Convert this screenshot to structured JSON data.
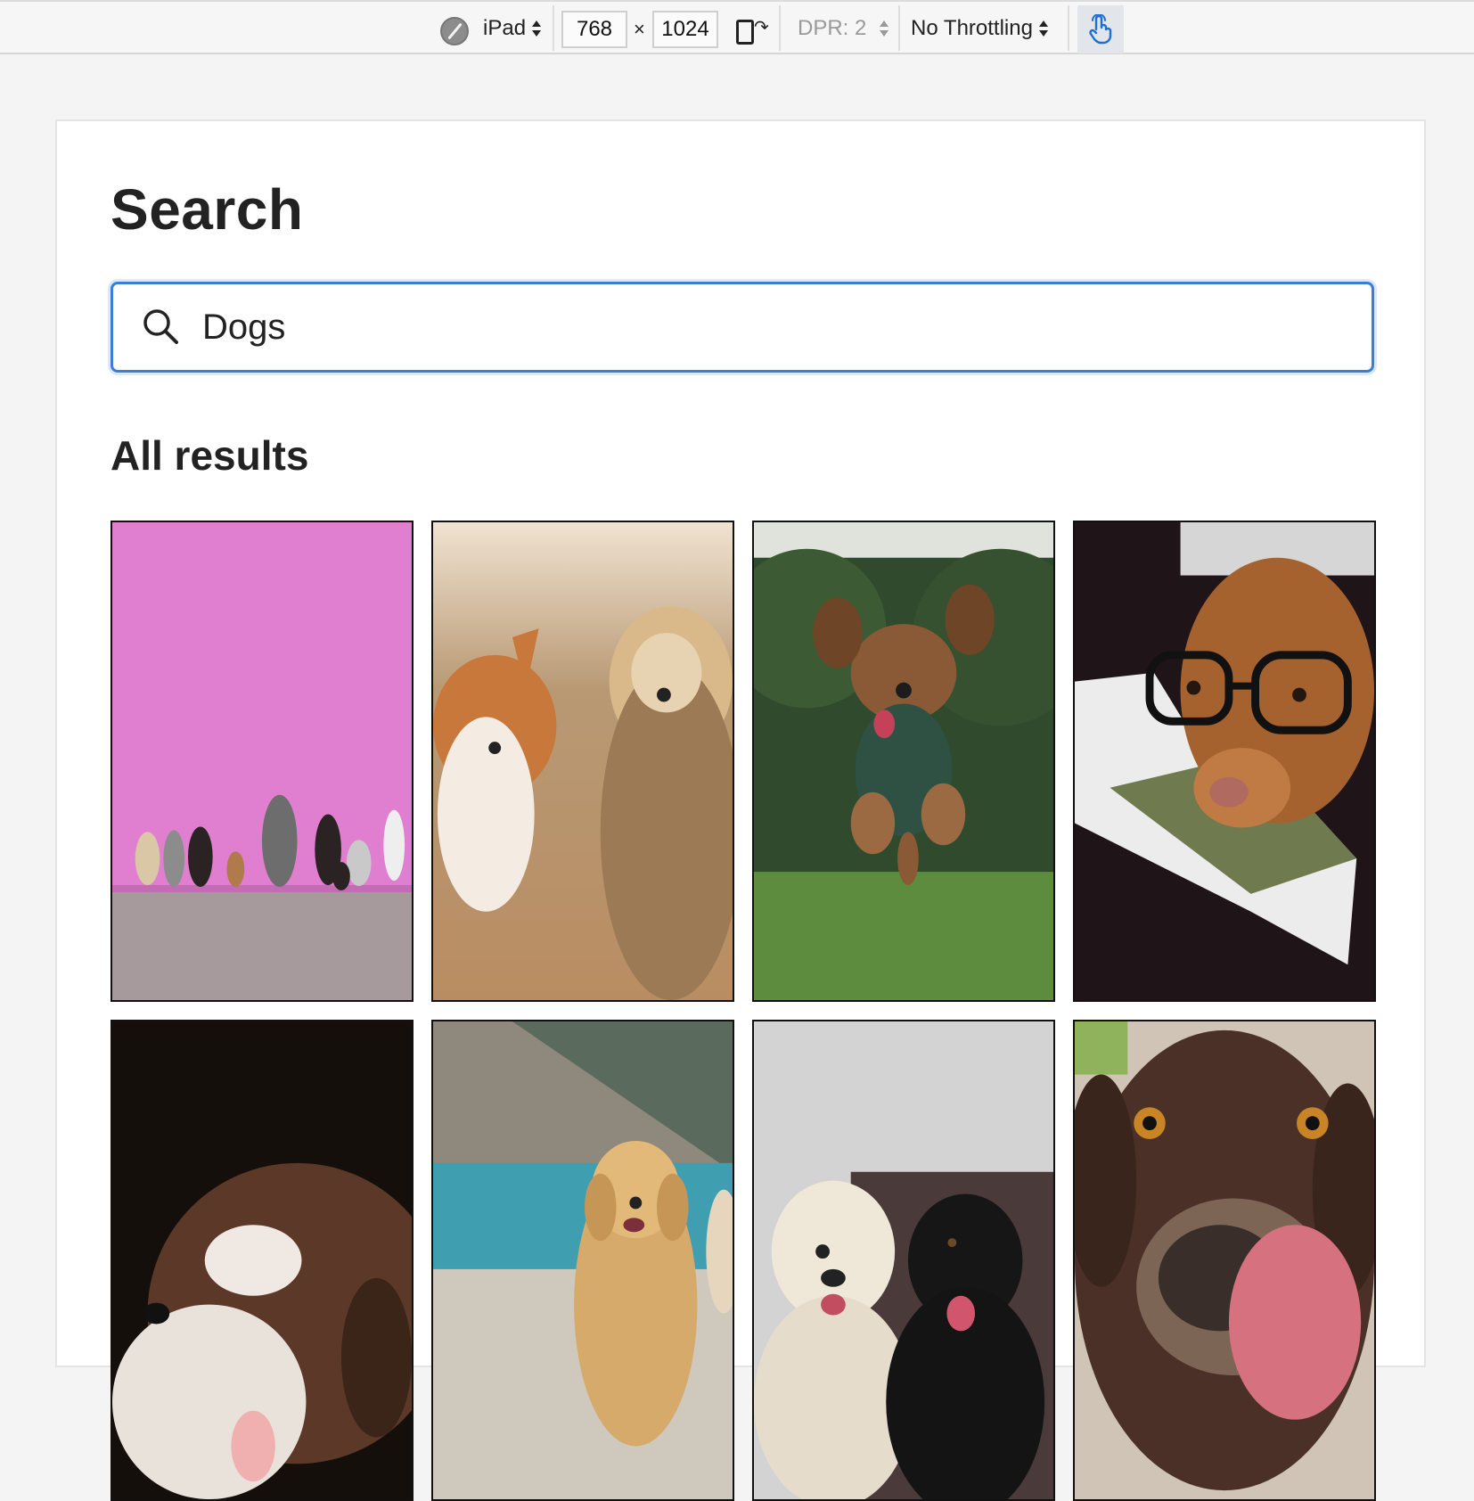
{
  "toolbar": {
    "device": "iPad",
    "width": "768",
    "height": "1024",
    "times": "×",
    "dpr": "DPR: 2",
    "throttling": "No Throttling"
  },
  "page": {
    "title": "Search",
    "search": {
      "value": "Dogs"
    },
    "section_title": "All results"
  },
  "colors": {
    "accent": "#3b7ddd",
    "text": "#222222",
    "toolbar_bg": "#f6f6f6"
  },
  "results": [
    {
      "icon": "dogs-against-pink-wall-photo"
    },
    {
      "icon": "corgi-and-terrier-photo"
    },
    {
      "icon": "jumping-doodle-photo"
    },
    {
      "icon": "dog-with-glasses-photo"
    },
    {
      "icon": "sleeping-puppy-photo"
    },
    {
      "icon": "golden-retriever-lake-photo"
    },
    {
      "icon": "doodle-and-black-lab-photo"
    },
    {
      "icon": "dog-licking-nose-photo"
    }
  ]
}
